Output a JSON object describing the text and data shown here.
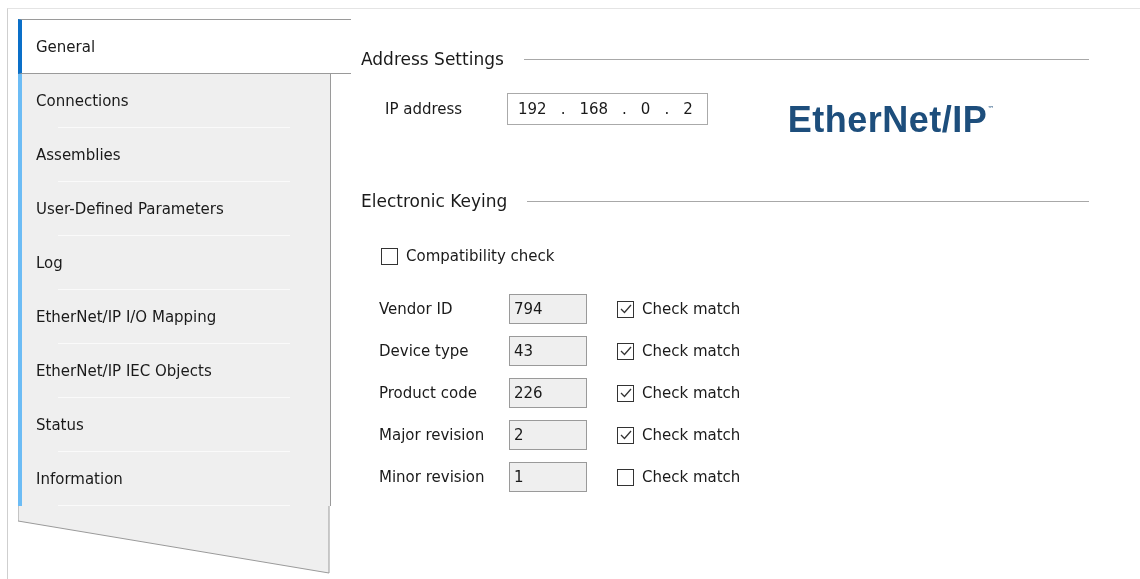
{
  "sidebar": {
    "items": [
      {
        "label": "General",
        "selected": true
      },
      {
        "label": "Connections",
        "selected": false
      },
      {
        "label": "Assemblies",
        "selected": false
      },
      {
        "label": "User-Defined Parameters",
        "selected": false
      },
      {
        "label": "Log",
        "selected": false
      },
      {
        "label": "EtherNet/IP I/O Mapping",
        "selected": false
      },
      {
        "label": "EtherNet/IP IEC Objects",
        "selected": false
      },
      {
        "label": "Status",
        "selected": false
      },
      {
        "label": "Information",
        "selected": false
      }
    ]
  },
  "address_settings": {
    "heading": "Address Settings",
    "ip_label": "IP address",
    "ip_octets": [
      "192",
      "168",
      "0",
      "2"
    ],
    "ip_dots": [
      ".",
      ".",
      "."
    ],
    "logo": {
      "text": "EtherNet/IP",
      "trademark": "™"
    }
  },
  "electronic_keying": {
    "heading": "Electronic Keying",
    "compatibility": {
      "label": "Compatibility check",
      "checked": false
    },
    "rows": [
      {
        "label": "Vendor ID",
        "value": "794",
        "check_label": "Check match",
        "checked": true
      },
      {
        "label": "Device type",
        "value": "43",
        "check_label": "Check match",
        "checked": true
      },
      {
        "label": "Product code",
        "value": "226",
        "check_label": "Check match",
        "checked": true
      },
      {
        "label": "Major revision",
        "value": "2",
        "check_label": "Check match",
        "checked": true
      },
      {
        "label": "Minor revision",
        "value": "1",
        "check_label": "Check match",
        "checked": false
      }
    ]
  }
}
